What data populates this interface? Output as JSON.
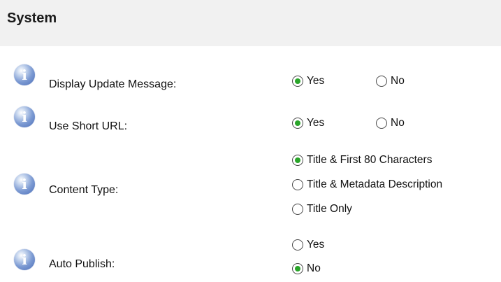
{
  "section": {
    "title": "System"
  },
  "settings": [
    {
      "label": "Display Update Message:",
      "options": [
        {
          "label": "Yes",
          "checked": true
        },
        {
          "label": "No",
          "checked": false
        }
      ]
    },
    {
      "label": "Use Short URL:",
      "options": [
        {
          "label": "Yes",
          "checked": true
        },
        {
          "label": "No",
          "checked": false
        }
      ]
    },
    {
      "label": "Content Type:",
      "options": [
        {
          "label": "Title & First 80 Characters",
          "checked": true
        },
        {
          "label": "Title & Metadata Description",
          "checked": false
        },
        {
          "label": "Title Only",
          "checked": false
        }
      ]
    },
    {
      "label": "Auto Publish:",
      "options": [
        {
          "label": "Yes",
          "checked": false
        },
        {
          "label": "No",
          "checked": true
        }
      ]
    }
  ],
  "icons": {
    "info": "info-icon",
    "info_glyph": "i"
  },
  "colors": {
    "header_bg": "#f1f1f1",
    "radio_selected": "#2aa52a",
    "info_icon": "#6f8fce"
  }
}
